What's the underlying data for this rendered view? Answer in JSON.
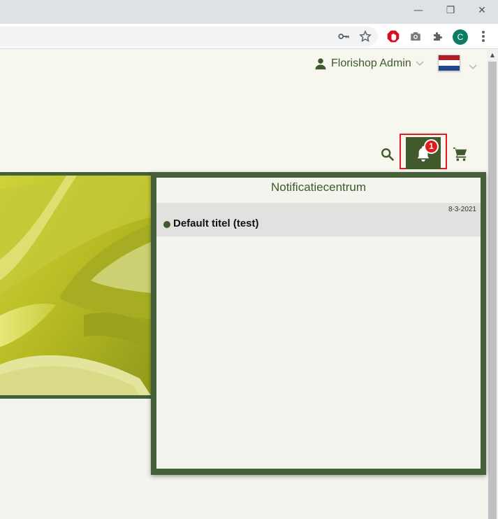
{
  "browser": {
    "window_controls": {
      "minimize": "—",
      "restore": "❐",
      "close": "✕"
    },
    "toolbar_icons": [
      "key-icon",
      "star-icon",
      "adblock-icon",
      "camera-icon",
      "extensions-icon",
      "profile-avatar",
      "more-icon"
    ],
    "profile_initial": "C"
  },
  "header": {
    "user_name": "Florishop Admin",
    "language_flag": "Netherlands",
    "flag_colors": [
      "#ae1c28",
      "#ffffff",
      "#21468b"
    ]
  },
  "actions": {
    "notification_count": "1"
  },
  "colors": {
    "brand_green": "#405a2c",
    "badge_red": "#e21c1c",
    "highlight_border": "#e21c1c"
  },
  "notifications": {
    "panel_title": "Notificatiecentrum",
    "items": [
      {
        "date": "8-3-2021",
        "title": "Default titel (test)"
      }
    ]
  }
}
